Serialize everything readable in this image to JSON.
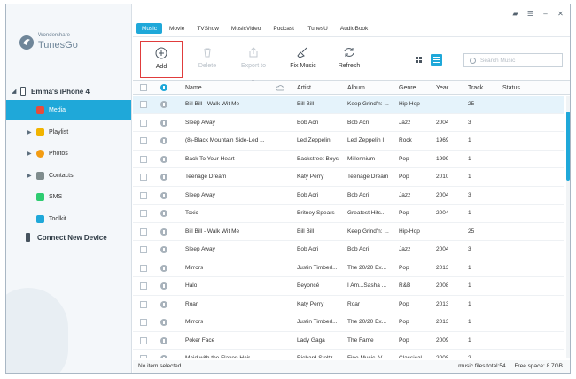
{
  "app": {
    "brand_sub": "Wondershare",
    "brand_name": "TunesGo"
  },
  "sidebar": {
    "device": "Emma's iPhone 4",
    "items": [
      {
        "label": "Media",
        "icon": "media-icon",
        "color": "#e74c3c",
        "active": true
      },
      {
        "label": "Playlist",
        "icon": "playlist-icon",
        "color": "#f1b400"
      },
      {
        "label": "Photos",
        "icon": "photos-icon",
        "color": "#f39c12"
      },
      {
        "label": "Contacts",
        "icon": "contacts-icon",
        "color": "#7f8c8d"
      },
      {
        "label": "SMS",
        "icon": "sms-icon",
        "color": "#2ecc71"
      },
      {
        "label": "Toolkit",
        "icon": "toolkit-icon",
        "color": "#1fa8d9"
      }
    ],
    "connect": "Connect New Device"
  },
  "tabs": [
    "Music",
    "Movie",
    "TVShow",
    "MusicVideo",
    "Podcast",
    "iTunesU",
    "AudioBook"
  ],
  "toolbar": {
    "add": "Add",
    "delete": "Delete",
    "export": "Export to",
    "fix": "Fix Music",
    "refresh": "Refresh"
  },
  "search": {
    "placeholder": "Search Music"
  },
  "columns": {
    "name": "Name",
    "artist": "Artist",
    "album": "Album",
    "genre": "Genre",
    "year": "Year",
    "track": "Track",
    "status": "Status"
  },
  "rows": [
    {
      "name": "Bill Bill - Walk Wit Me",
      "artist": "Bill Bill",
      "album": "Keep Grind'n: ...",
      "genre": "Hip-Hop",
      "year": "",
      "track": "25"
    },
    {
      "name": "Sleep Away",
      "artist": "Bob Acri",
      "album": "Bob Acri",
      "genre": "Jazz",
      "year": "2004",
      "track": "3"
    },
    {
      "name": "(8)-Black Mountain Side-Led ...",
      "artist": "Led Zeppelin",
      "album": "Led Zeppelin I",
      "genre": "Rock",
      "year": "1969",
      "track": "1"
    },
    {
      "name": "Back To Your Heart",
      "artist": "Backstreet Boys",
      "album": "Millennium",
      "genre": "Pop",
      "year": "1999",
      "track": "1"
    },
    {
      "name": "Teenage Dream",
      "artist": "Katy Perry",
      "album": "Teenage Dream",
      "genre": "Pop",
      "year": "2010",
      "track": "1"
    },
    {
      "name": "Sleep Away",
      "artist": "Bob Acri",
      "album": "Bob Acri",
      "genre": "Jazz",
      "year": "2004",
      "track": "3"
    },
    {
      "name": "Toxic",
      "artist": "Britney Spears",
      "album": "Greatest Hits...",
      "genre": "Pop",
      "year": "2004",
      "track": "1"
    },
    {
      "name": "Bill Bill - Walk Wit Me",
      "artist": "Bill Bill",
      "album": "Keep Grind'n: ...",
      "genre": "Hip-Hop",
      "year": "",
      "track": "25"
    },
    {
      "name": "Sleep Away",
      "artist": "Bob Acri",
      "album": "Bob Acri",
      "genre": "Jazz",
      "year": "2004",
      "track": "3"
    },
    {
      "name": "Mirrors",
      "artist": "Justin Timberl...",
      "album": "The 20/20 Ex...",
      "genre": "Pop",
      "year": "2013",
      "track": "1"
    },
    {
      "name": "Halo",
      "artist": "Beyoncé",
      "album": "I Am...Sasha ...",
      "genre": "R&B",
      "year": "2008",
      "track": "1"
    },
    {
      "name": "Roar",
      "artist": "Katy Perry",
      "album": "Roar",
      "genre": "Pop",
      "year": "2013",
      "track": "1"
    },
    {
      "name": "Mirrors",
      "artist": "Justin Timberl...",
      "album": "The 20/20 Ex...",
      "genre": "Pop",
      "year": "2013",
      "track": "1"
    },
    {
      "name": "Poker Face",
      "artist": "Lady Gaga",
      "album": "The Fame",
      "genre": "Pop",
      "year": "2009",
      "track": "1"
    },
    {
      "name": "Maid with the Flaxen Hair",
      "artist": "Richard Stoltz",
      "album": "Fine Music, V...",
      "genre": "Classical",
      "year": "2008",
      "track": "2"
    }
  ],
  "status": {
    "left": "No item selected",
    "files": "music files total:54",
    "space": "Free space: 8.7GB"
  }
}
